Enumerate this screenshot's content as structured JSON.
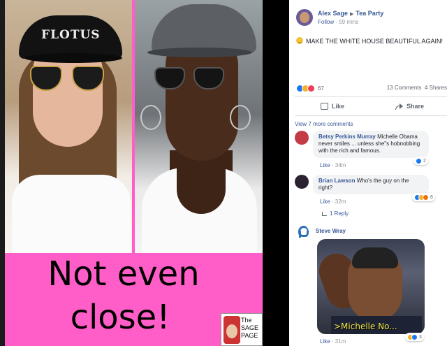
{
  "meme": {
    "cap_text": "FLOTUS",
    "caption_line1": "Not even",
    "caption_line2": "close!",
    "logo_text": "The SAGE PAGE"
  },
  "post": {
    "author": "Alex Sage",
    "group": "Tea Party",
    "follow": "Follow",
    "time": "59 mins",
    "text": "MAKE THE WHITE HOUSE BEAUTIFUL AGAIN!",
    "reaction_count": "67",
    "comments_count": "13 Comments",
    "shares_count": "4 Shares",
    "like_label": "Like",
    "share_label": "Share",
    "view_more": "View 7 more comments"
  },
  "comments": [
    {
      "name": "Betsy Perkins Murray",
      "text": "Michelle Obama never smiles ... unless she\"s hobnobbing with the rich and famous.",
      "like": "Like",
      "time": "34m",
      "react_count": "2"
    },
    {
      "name": "Brian Lawson",
      "text": "Who's the guy on the right?",
      "like": "Like",
      "time": "32m",
      "react_count": "6"
    },
    {
      "name": "Steve Wray",
      "gif_caption": ">Michelle No...",
      "like": "Like",
      "time": "31m",
      "react_count": "3"
    }
  ],
  "reply_label": "1 Reply",
  "colors": {
    "fb_blue": "#385898",
    "meme_pink": "#ff5ec8",
    "muted": "#90949c"
  }
}
